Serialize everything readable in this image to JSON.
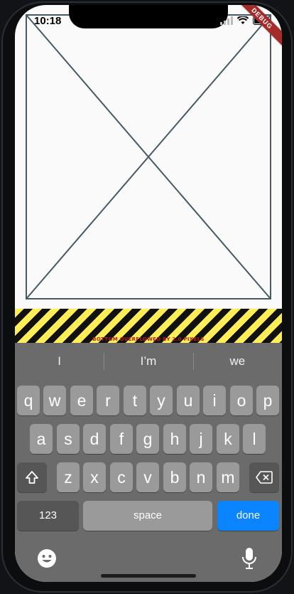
{
  "status": {
    "time": "10:18"
  },
  "debug_banner": "DEBUG",
  "overflow_message": "BOTTOM OVERFLOWED BY 2.0 PIXELS",
  "colors": {
    "placeholder_stroke": "#455a64",
    "done_key": "#0a84ff",
    "stripe_yellow": "#ffee58",
    "overflow_text": "#b71c1c"
  },
  "keyboard": {
    "suggestions": [
      "I",
      "I’m",
      "we"
    ],
    "row1": [
      "q",
      "w",
      "e",
      "r",
      "t",
      "y",
      "u",
      "i",
      "o",
      "p"
    ],
    "row2": [
      "a",
      "s",
      "d",
      "f",
      "g",
      "h",
      "j",
      "k",
      "l"
    ],
    "row3": [
      "z",
      "x",
      "c",
      "v",
      "b",
      "n",
      "m"
    ],
    "numbers_label": "123",
    "space_label": "space",
    "done_label": "done",
    "icons": [
      "shift-icon",
      "backspace-icon",
      "emoji-icon",
      "microphone-icon"
    ]
  }
}
